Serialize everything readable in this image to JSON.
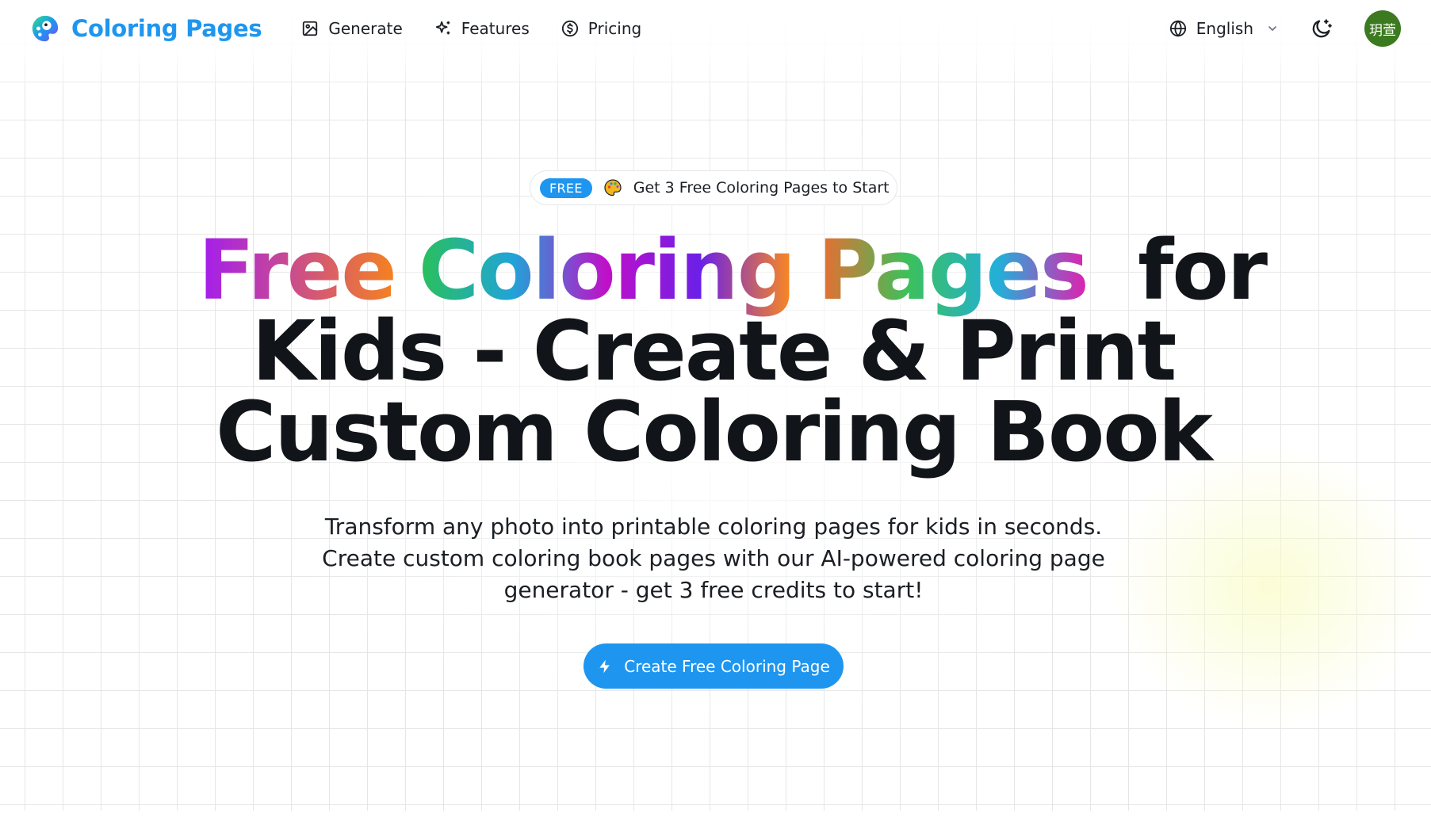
{
  "nav": {
    "brand": "Coloring Pages",
    "links": [
      {
        "label": "Generate",
        "icon": "image-icon"
      },
      {
        "label": "Features",
        "icon": "sparkles-icon"
      },
      {
        "label": "Pricing",
        "icon": "dollar-circle-icon"
      }
    ],
    "language": "English",
    "avatar_text": "玥萱"
  },
  "hero": {
    "badge_tag": "FREE",
    "badge_text": "Get 3 Free Coloring Pages to Start",
    "title_words": [
      {
        "text": "Free",
        "gradient": [
          "#a21cf0",
          "#f5821f"
        ]
      },
      {
        "text": "Coloring",
        "gradient": [
          "#2ac05a",
          "#20a4d8",
          "#c010c8",
          "#6a20e8",
          "#ff8c1a"
        ]
      },
      {
        "text": "Pages",
        "gradient": [
          "#f06a30",
          "#3cc05a",
          "#22b0d8",
          "#e020b0"
        ]
      }
    ],
    "title_rest_1": "for",
    "title_line_2": "Kids - Create & Print",
    "title_line_3": "Custom Coloring Book",
    "subtitle": "Transform any photo into printable coloring pages for kids in seconds. Create custom coloring book pages with our AI-powered coloring page generator - get 3 free credits to start!",
    "cta_label": "Create Free Coloring Page"
  },
  "colors": {
    "accent": "#1e96f0",
    "text": "#111418",
    "avatar_bg": "#3c7a1f"
  }
}
